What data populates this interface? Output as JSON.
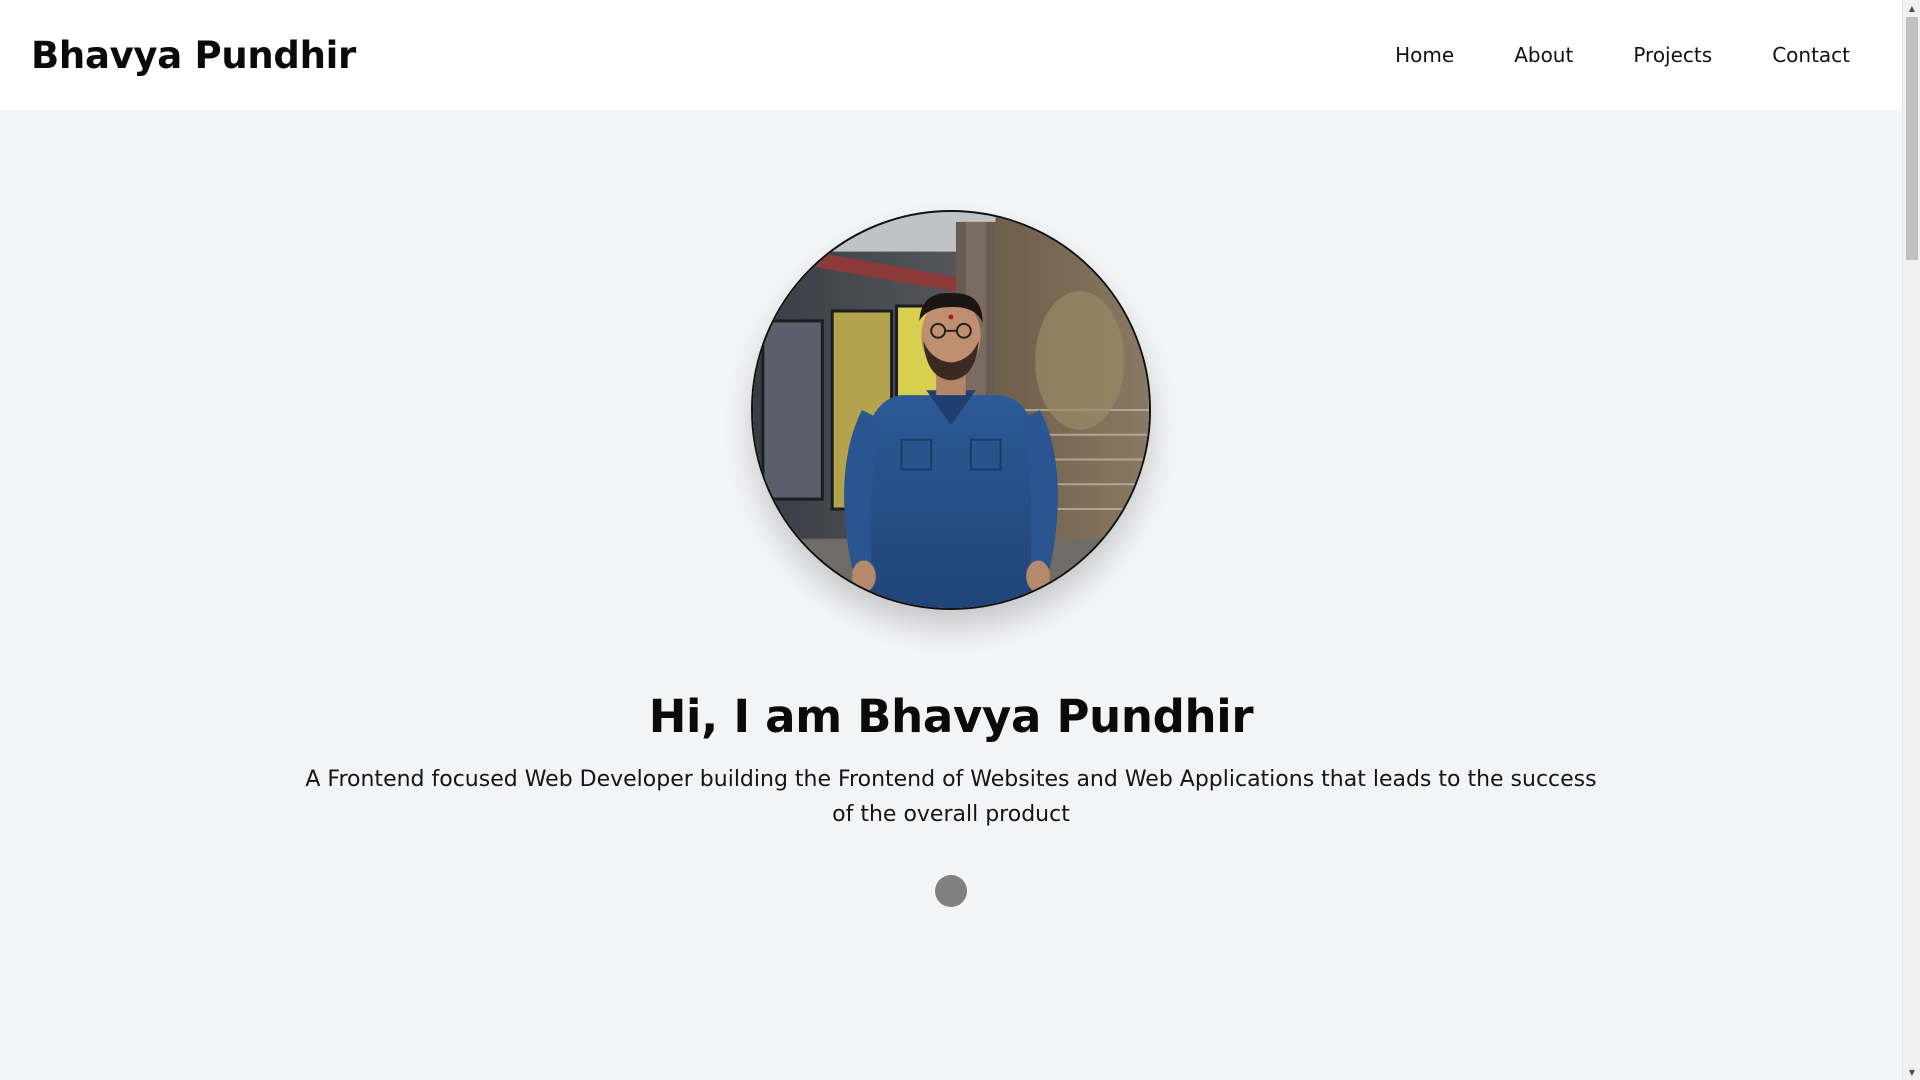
{
  "header": {
    "brand": "Bhavya Pundhir",
    "nav": [
      {
        "label": "Home"
      },
      {
        "label": "About"
      },
      {
        "label": "Projects"
      },
      {
        "label": "Contact"
      }
    ]
  },
  "hero": {
    "avatar_icon": "profile-photo",
    "headline": "Hi, I am Bhavya Pundhir",
    "tagline": "A Frontend focused Web Developer building the Frontend of Websites and Web Applications that leads to the success of the overall product"
  },
  "colors": {
    "background": "#f3f4f6",
    "header_bg": "#ffffff",
    "text": "#0a0a0a",
    "indicator": "#808080"
  }
}
